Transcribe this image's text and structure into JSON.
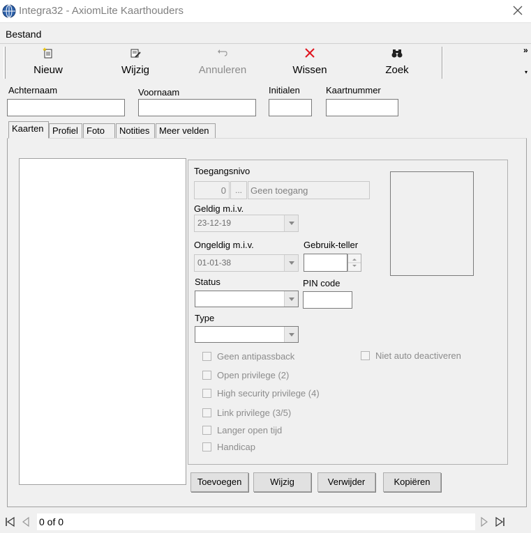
{
  "window": {
    "title": "Integra32 - AxiomLite Kaarthouders"
  },
  "menu": {
    "items": [
      "Bestand"
    ]
  },
  "toolbar": {
    "buttons": [
      {
        "label": "Nieuw",
        "icon": "new-document-icon",
        "enabled": true
      },
      {
        "label": "Wijzig",
        "icon": "edit-icon",
        "enabled": true
      },
      {
        "label": "Annuleren",
        "icon": "undo-icon",
        "enabled": false
      },
      {
        "label": "Wissen",
        "icon": "delete-x-icon",
        "enabled": true
      },
      {
        "label": "Zoek",
        "icon": "binoculars-icon",
        "enabled": true
      }
    ],
    "overflow": "»"
  },
  "fields": {
    "achternaam": {
      "label": "Achternaam",
      "value": ""
    },
    "voornaam": {
      "label": "Voornaam",
      "value": ""
    },
    "initialen": {
      "label": "Initialen",
      "value": ""
    },
    "kaartnummer": {
      "label": "Kaartnummer",
      "value": ""
    }
  },
  "tabs": [
    "Kaarten",
    "Profiel",
    "Foto",
    "Notities",
    "Meer velden"
  ],
  "active_tab": "Kaarten",
  "card": {
    "toegangsnivo": {
      "label": "Toegangsnivo",
      "number": "0",
      "browse": "...",
      "text": "Geen toegang"
    },
    "geldig": {
      "label": "Geldig m.i.v.",
      "value": "23-12-19"
    },
    "ongeldig": {
      "label": "Ongeldig m.i.v.",
      "value": "01-01-38"
    },
    "gebruik_teller": {
      "label": "Gebruik-teller",
      "value": ""
    },
    "status": {
      "label": "Status",
      "value": ""
    },
    "pin": {
      "label": "PIN code",
      "value": ""
    },
    "type": {
      "label": "Type",
      "value": ""
    },
    "checkboxes": [
      "Geen antipassback",
      "Open privilege (2)",
      "High security privilege (4)",
      "Link privilege (3/5)",
      "Langer open tijd",
      "Handicap"
    ],
    "niet_auto": "Niet auto deactiveren"
  },
  "buttons": {
    "toevoegen": "Toevoegen",
    "wijzig": "Wijzig",
    "verwijder": "Verwijder",
    "kopieren": "Kopiëren"
  },
  "navigator": {
    "position": "0 of 0"
  },
  "colors": {
    "delete_red": "#e0141e",
    "disabled_text": "#8c8c8c"
  }
}
